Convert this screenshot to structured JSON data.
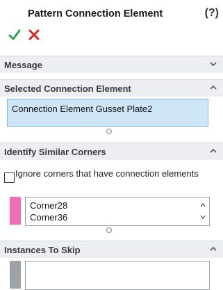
{
  "header": {
    "title": "Pattern Connection Element",
    "help_symbol": "?",
    "ok_icon": "checkmark-icon",
    "cancel_icon": "x-icon"
  },
  "sections": {
    "message": {
      "label": "Message"
    },
    "selected": {
      "label": "Selected Connection Element",
      "item": "Connection Element Gusset Plate2"
    },
    "identify": {
      "label": "Identify Similar Corners",
      "checkbox_label": "Ignore corners that have connection elements",
      "checkbox_checked": false,
      "corners": [
        "Corner28",
        "Corner36"
      ],
      "swatch_color": "#f06fb4"
    },
    "skip": {
      "label": "Instances To Skip"
    }
  },
  "colors": {
    "ok": "#2aa24a",
    "cancel": "#e02020",
    "selected_bg": "#cfe6f7",
    "section_bg": "#eceef1"
  }
}
